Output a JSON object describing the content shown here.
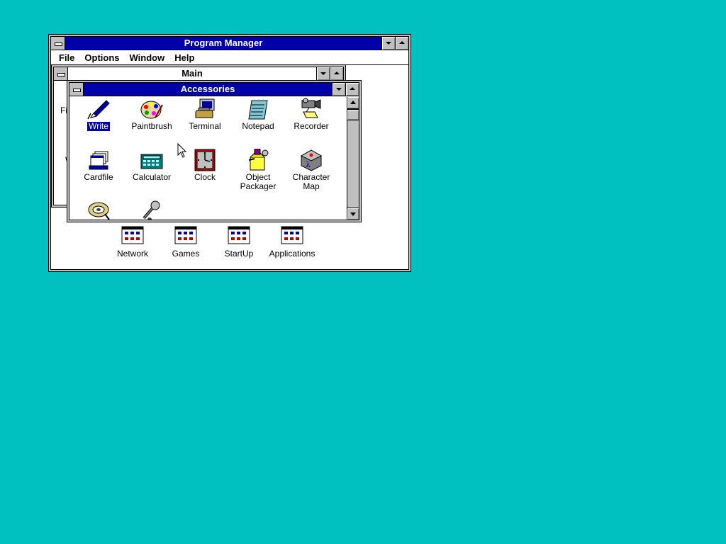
{
  "program_manager": {
    "title": "Program Manager",
    "menu": [
      "File",
      "Options",
      "Window",
      "Help"
    ],
    "group_icons": [
      {
        "label": "Network",
        "icon": "program-group-icon"
      },
      {
        "label": "Games",
        "icon": "program-group-icon"
      },
      {
        "label": "StartUp",
        "icon": "program-group-icon"
      },
      {
        "label": "Applications",
        "icon": "program-group-icon"
      }
    ]
  },
  "main_group": {
    "title": "Main",
    "partial_labels": [
      "Fi",
      "W"
    ]
  },
  "accessories": {
    "title": "Accessories",
    "items": [
      {
        "label": "Write",
        "icon": "write-pen-icon",
        "selected": true
      },
      {
        "label": "Paintbrush",
        "icon": "paint-palette-icon"
      },
      {
        "label": "Terminal",
        "icon": "terminal-phone-icon"
      },
      {
        "label": "Notepad",
        "icon": "notepad-icon"
      },
      {
        "label": "Recorder",
        "icon": "recorder-camera-icon"
      },
      {
        "label": "Cardfile",
        "icon": "cardfile-icon"
      },
      {
        "label": "Calculator",
        "icon": "calculator-icon"
      },
      {
        "label": "Clock",
        "icon": "clock-icon"
      },
      {
        "label": "Object\nPackager",
        "icon": "object-packager-icon"
      },
      {
        "label": "Character Map",
        "icon": "character-map-icon"
      },
      {
        "label": "",
        "icon": "media-player-reel-icon"
      },
      {
        "label": "",
        "icon": "sound-recorder-mic-icon"
      }
    ]
  },
  "colors": {
    "desktop": "#00c0c0",
    "active_title": "#0000a8",
    "selection": "#0000a8",
    "chrome": "#c0c0c0"
  }
}
